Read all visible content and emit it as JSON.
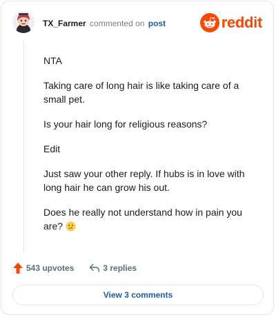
{
  "header": {
    "username": "TX_Farmer",
    "action": "commented on",
    "target": "post",
    "brand": "reddit",
    "avatar_icon": "user-avatar-icon",
    "logo_icon": "reddit-alien-icon",
    "brand_color": "#ff4500"
  },
  "comment": {
    "paragraphs": [
      "NTA",
      "Taking care of long hair is like taking care of a small pet.",
      "Is your hair long for religious reasons?",
      "Edit",
      "Just saw your other reply. If hubs is in love with long hair he can grow his out.",
      "Does he really not understand how in pain you are?"
    ],
    "emoji": "confused-face-emoji"
  },
  "actions": {
    "upvotes": "543 upvotes",
    "replies": "3 replies",
    "upvote_icon": "upvote-arrow-icon",
    "reply_icon": "reply-arrow-icon",
    "upvote_color": "#ff4500"
  },
  "footer": {
    "view_label": "View 3 comments",
    "link_color": "#1a5ea8"
  }
}
